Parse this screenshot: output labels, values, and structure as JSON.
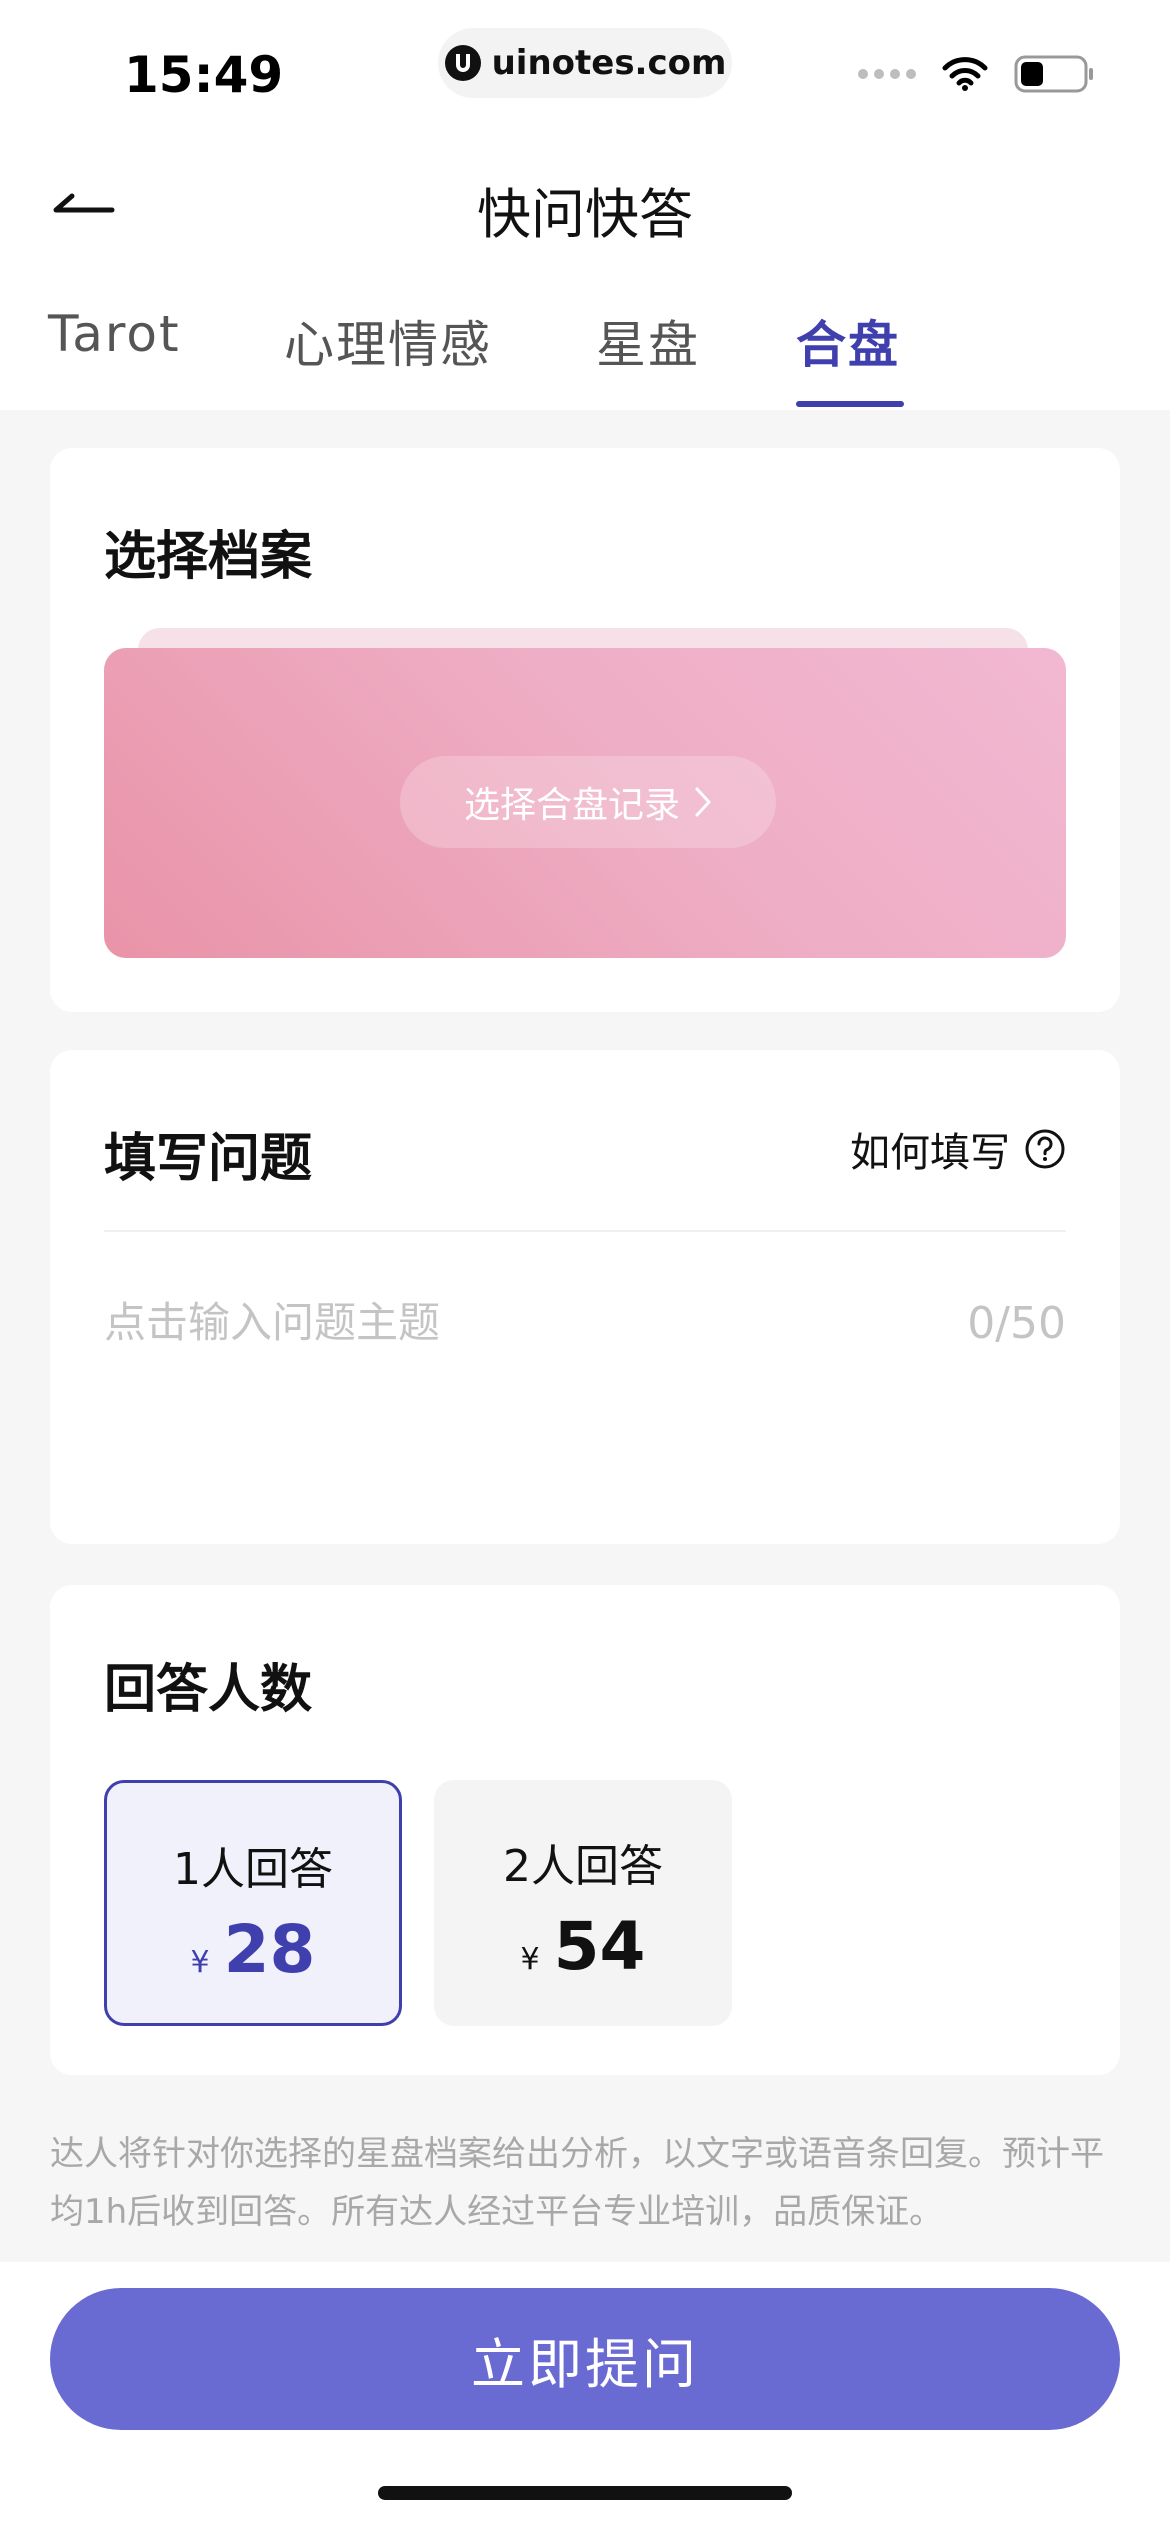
{
  "status_bar": {
    "time": "15:49",
    "url": "uinotes.com"
  },
  "nav": {
    "title": "快问快答"
  },
  "tabs": [
    {
      "label": "Tarot"
    },
    {
      "label": "心理情感"
    },
    {
      "label": "星盘"
    },
    {
      "label": "合盘",
      "active": true
    }
  ],
  "archive": {
    "title": "选择档案",
    "select_label": "选择合盘记录"
  },
  "question": {
    "title": "填写问题",
    "howto_label": "如何填写",
    "placeholder": "点击输入问题主题",
    "count": "0/50"
  },
  "answer": {
    "title": "回答人数",
    "options": [
      {
        "label": "1人回答",
        "currency": "¥",
        "price": "28",
        "selected": true
      },
      {
        "label": "2人回答",
        "currency": "¥",
        "price": "54",
        "selected": false
      }
    ]
  },
  "notice": "达人将针对你选择的星盘档案给出分析，以文字或语音条回复。预计平均1h后收到回答。所有达人经过平台专业培训，品质保证。",
  "submit_label": "立即提问",
  "colors": {
    "accent": "#3f3fae",
    "button": "#6a6bd2",
    "card_pink": "#eeadc4"
  },
  "icons": {
    "back": "arrow-left-icon",
    "help": "question-circle-icon",
    "chevron": "chevron-right-icon",
    "wifi": "wifi-icon",
    "battery": "battery-icon"
  }
}
